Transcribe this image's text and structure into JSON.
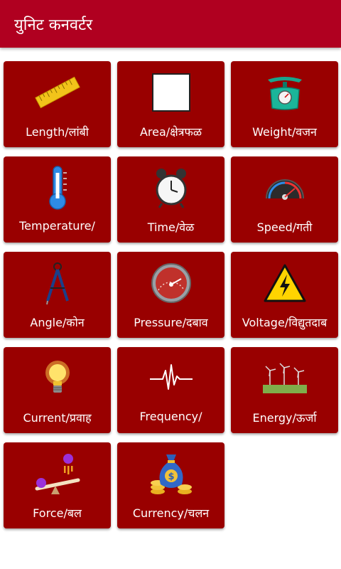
{
  "app": {
    "title": "युनिट कनवर्टर"
  },
  "converters": [
    {
      "label": "Length/लांबी",
      "icon": "ruler-icon"
    },
    {
      "label": "Area/क्षेत्रफळ",
      "icon": "square-icon"
    },
    {
      "label": "Weight/वजन",
      "icon": "scale-icon"
    },
    {
      "label": "Temperature/",
      "icon": "thermometer-icon"
    },
    {
      "label": "Time/वेळ",
      "icon": "alarm-clock-icon"
    },
    {
      "label": "Speed/गती",
      "icon": "speedometer-icon"
    },
    {
      "label": "Angle/कोन",
      "icon": "compass-icon"
    },
    {
      "label": "Pressure/दबाव",
      "icon": "pressure-gauge-icon"
    },
    {
      "label": "Voltage/विद्युतदाब",
      "icon": "high-voltage-icon"
    },
    {
      "label": "Current/प्रवाह",
      "icon": "light-bulb-icon"
    },
    {
      "label": "Frequency/",
      "icon": "pulse-wave-icon"
    },
    {
      "label": "Energy/ऊर्जा",
      "icon": "wind-turbines-icon"
    },
    {
      "label": "Force/बल",
      "icon": "seesaw-icon"
    },
    {
      "label": "Currency/चलन",
      "icon": "money-bag-icon"
    }
  ]
}
